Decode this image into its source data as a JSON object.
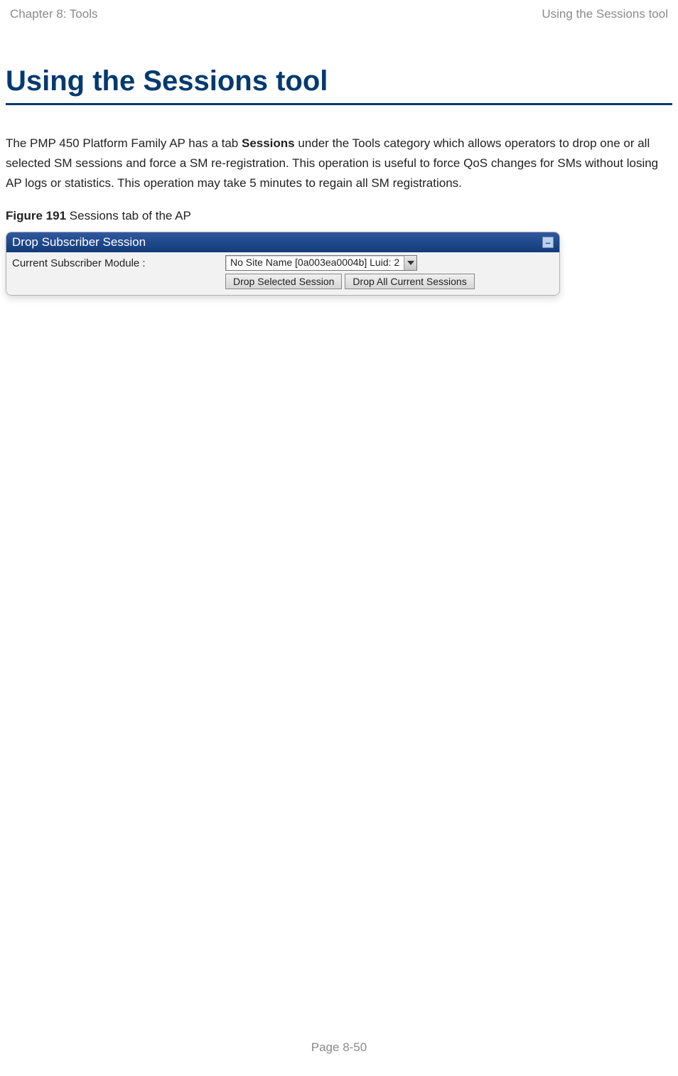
{
  "header": {
    "left": "Chapter 8:  Tools",
    "right": "Using the Sessions tool"
  },
  "heading": "Using the Sessions tool",
  "paragraph": {
    "part1": "The PMP 450 Platform Family AP has a tab ",
    "bold": "Sessions",
    "part2": " under the Tools category which allows operators to drop one or all selected SM sessions and force a SM re-registration. This operation is useful to force QoS changes for SMs without losing AP logs or statistics. This operation may take 5 minutes to regain all SM registrations."
  },
  "figure": {
    "label_bold": "Figure 191",
    "label_rest": " Sessions tab of the AP"
  },
  "panel": {
    "title": "Drop Subscriber Session",
    "row_label": "Current Subscriber Module :",
    "dropdown_value": "No Site Name [0a003ea0004b] Luid: 2",
    "btn_drop_selected": "Drop Selected Session",
    "btn_drop_all": "Drop All Current Sessions"
  },
  "footer": "Page 8-50"
}
